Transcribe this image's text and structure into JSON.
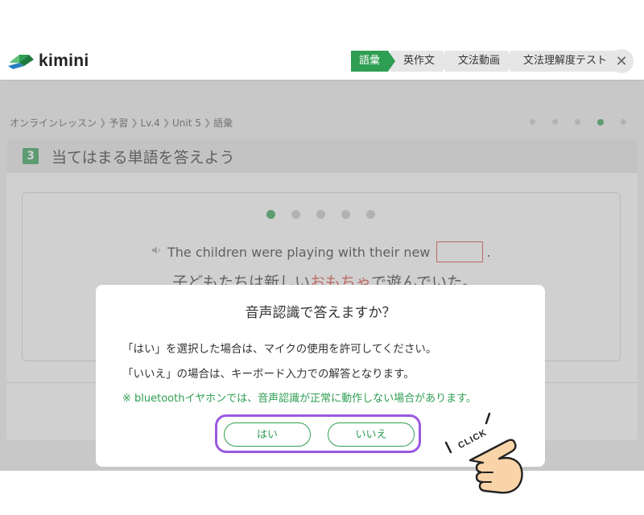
{
  "app": {
    "logo_text": "kimini",
    "steps": [
      {
        "label": "語彙",
        "active": true
      },
      {
        "label": "英作文",
        "active": false
      },
      {
        "label": "文法動画",
        "active": false
      },
      {
        "label": "文法理解度テスト",
        "active": false
      }
    ],
    "close_label": "✕"
  },
  "breadcrumb": {
    "items": [
      "オンラインレッスン",
      "予習",
      "Lv.4",
      "Unit 5",
      "語彙"
    ]
  },
  "progress": {
    "total": 5,
    "current": 4
  },
  "question": {
    "number": "3",
    "title": "当てはまる単語を答えよう",
    "sub_progress": {
      "total": 5,
      "current": 1
    },
    "sentence_before": "The children were playing with their new",
    "sentence_after": ".",
    "translation_before": "子どもたちは新しい",
    "translation_highlight": "おもちゃ",
    "translation_after": "で遊んでいた。"
  },
  "modal": {
    "title": "音声認識で答えますか？",
    "line1": "「はい」を選択した場合は、マイクの使用を許可してください。",
    "line2": "「いいえ」の場合は、キーボード入力での解答となります。",
    "note": "※ bluetoothイヤホンでは、音声認識が正常に動作しない場合があります。",
    "yes_label": "はい",
    "no_label": "いいえ"
  },
  "annotation": {
    "click_label": "CLICK"
  },
  "colors": {
    "accent": "#2e9e52",
    "highlight": "#d9453a",
    "focus_ring": "#9b59e0"
  }
}
